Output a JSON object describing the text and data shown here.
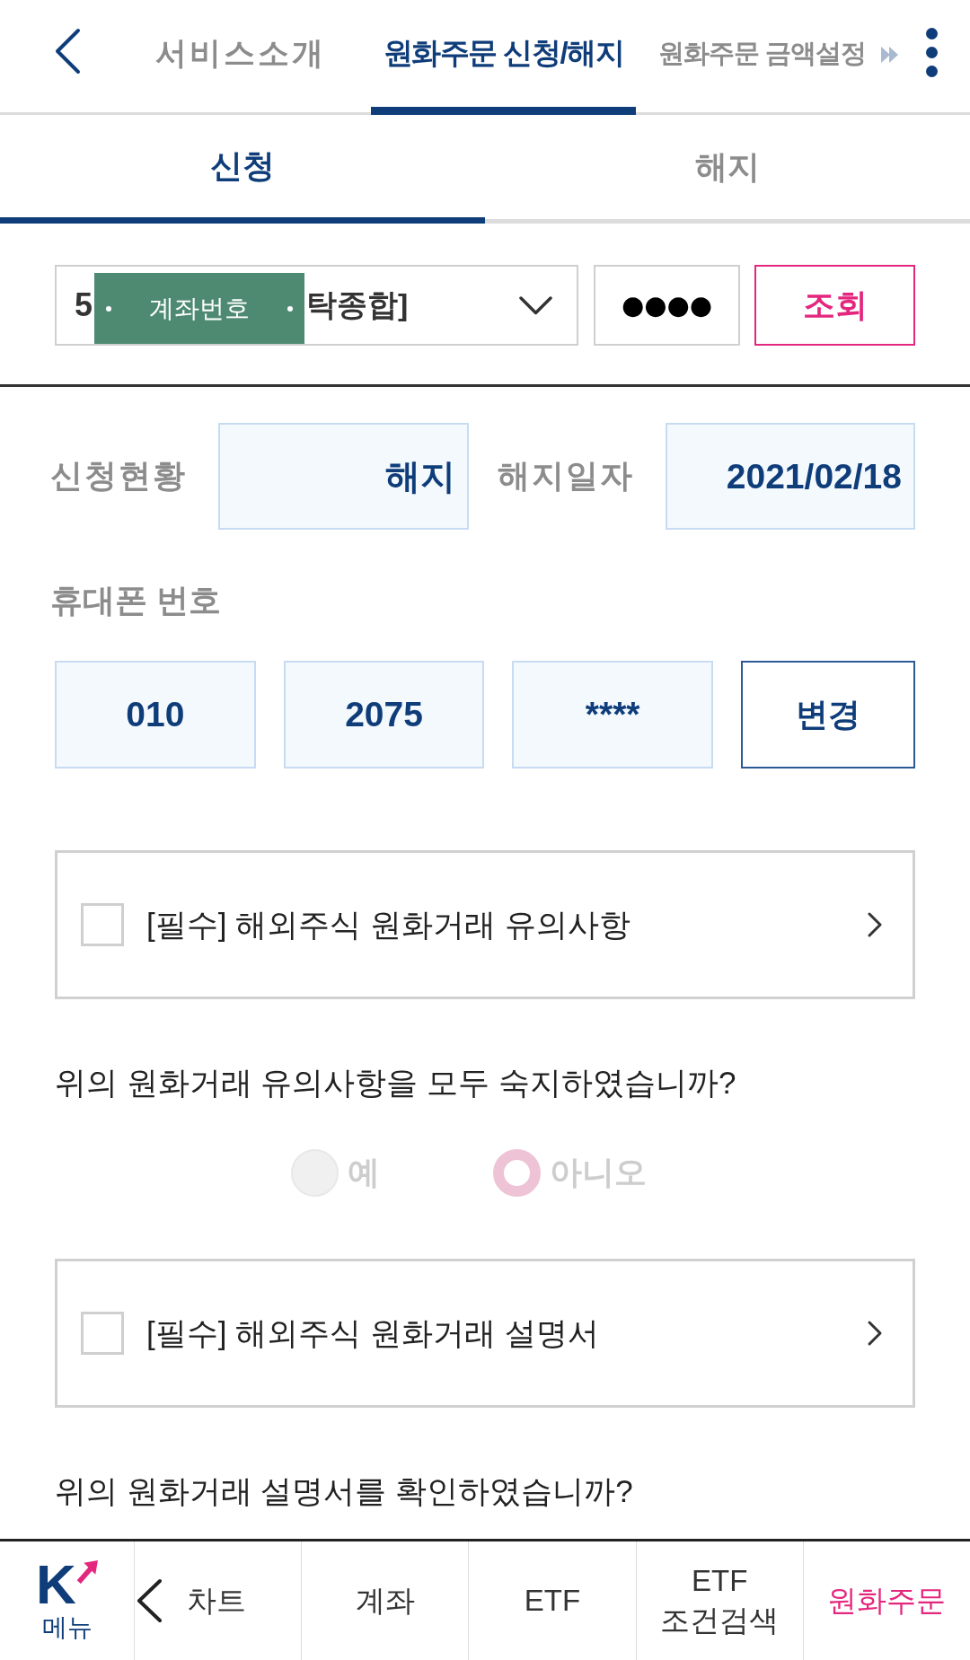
{
  "header": {
    "tabs": [
      {
        "label": "서비스소개",
        "selected": false
      },
      {
        "label": "원화주문 신청/해지",
        "selected": true
      },
      {
        "label": "원화주문 금액설정",
        "selected": false
      }
    ]
  },
  "sub_tabs": [
    {
      "label": "신청",
      "selected": true
    },
    {
      "label": "해지",
      "selected": false
    }
  ],
  "account": {
    "value_start": "5",
    "redaction": "계좌번호",
    "value_end": "탁종합]",
    "password": "●●●●",
    "button": "조회"
  },
  "status": [
    {
      "label": "신청현황",
      "value": "해지"
    },
    {
      "label": "해지일자",
      "value": "2021/02/18"
    }
  ],
  "phone": {
    "label": "휴대폰 번호",
    "parts": [
      "010",
      "2075",
      "****"
    ],
    "button": "변경"
  },
  "agreements": [
    {
      "label": "[필수] 해외주식 원화거래 유의사항",
      "checked": false,
      "question": "위의 원화거래 유의사항을 모두 숙지하였습니까?",
      "options": [
        {
          "label": "예",
          "selected": false,
          "disabled": true
        },
        {
          "label": "아니오",
          "selected": true,
          "disabled": true
        }
      ]
    },
    {
      "label": "[필수] 해외주식 원화거래 설명서",
      "checked": false,
      "question": "위의 원화거래 설명서를 확인하였습니까?"
    }
  ],
  "bottom_nav": [
    {
      "kind": "logo",
      "logo": "K",
      "label": "메뉴",
      "selected": false
    },
    {
      "kind": "back",
      "label": "차트",
      "selected": false
    },
    {
      "kind": "text",
      "label": "계좌",
      "selected": false
    },
    {
      "kind": "text",
      "label": "ETF",
      "selected": false
    },
    {
      "kind": "text",
      "label": "ETF\n조건검색",
      "selected": false
    },
    {
      "kind": "text",
      "label": "원화주문",
      "selected": true
    }
  ]
}
